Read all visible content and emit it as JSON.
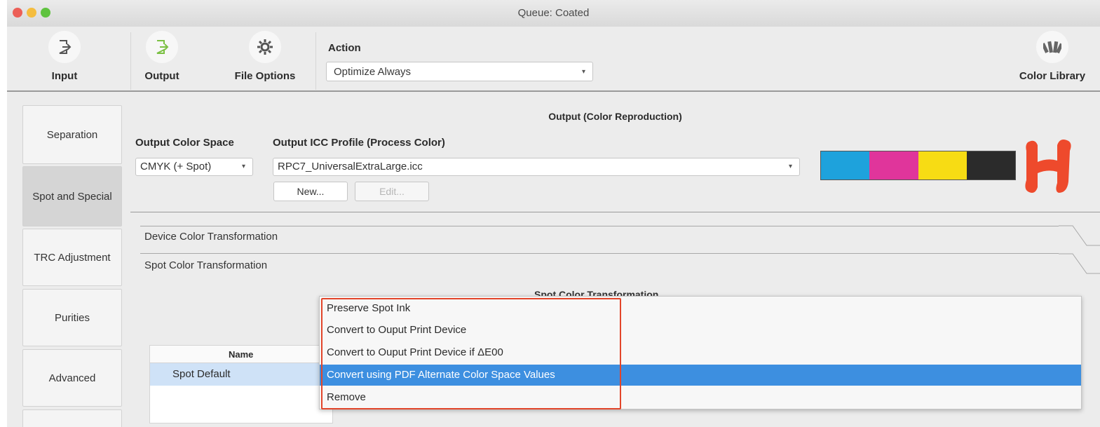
{
  "window": {
    "title": "Queue: Coated",
    "traffic_lights": {
      "close": "#ec5f57",
      "minimize": "#f5bd3f",
      "zoom": "#5fc33f"
    }
  },
  "toolbar": {
    "input_label": "Input",
    "output_label": "Output",
    "file_options_label": "File Options",
    "action_label": "Action",
    "action_value": "Optimize Always",
    "color_library_label": "Color Library",
    "icons": {
      "input": "input-arrow-icon",
      "output": "output-arrow-icon",
      "file_options": "gear-icon",
      "color_library": "color-fan-icon"
    },
    "output_icon_color": "#7bc043"
  },
  "sidebar": {
    "items": [
      {
        "label": "Separation",
        "active": false
      },
      {
        "label": "Spot and Special",
        "active": true
      },
      {
        "label": "TRC Adjustment",
        "active": false
      },
      {
        "label": "Purities",
        "active": false
      },
      {
        "label": "Advanced",
        "active": false
      }
    ]
  },
  "main": {
    "section_title": "Output (Color Reproduction)",
    "color_space_label": "Output Color Space",
    "color_space_value": "CMYK (+ Spot)",
    "icc_label": "Output ICC Profile (Process Color)",
    "icc_value": "RPC7_UniversalExtraLarge.icc",
    "new_button": "New...",
    "edit_button": "Edit...",
    "swatch_colors": [
      "#1ea2dc",
      "#e0359b",
      "#f7dc14",
      "#2b2b2b"
    ],
    "logo_colors": [
      "#f0542d",
      "#e8352a"
    ],
    "disclosures": [
      "Device Color Transformation",
      "Spot Color Transformation"
    ],
    "spot_section_title": "Spot Color Transformation",
    "table": {
      "header": "Name",
      "rows": [
        "Spot Default"
      ]
    }
  },
  "dropdown_menu": {
    "items": [
      {
        "label": "Preserve Spot Ink",
        "selected": false
      },
      {
        "label": "Convert to Ouput Print Device",
        "selected": false
      },
      {
        "label": "Convert to Ouput Print Device if ΔE00",
        "selected": false
      },
      {
        "label": "Convert using PDF Alternate Color Space Values",
        "selected": true
      },
      {
        "label": "Remove",
        "selected": false
      }
    ],
    "highlight_color": "#3d8fe0",
    "annotation_color": "#e2452a"
  }
}
